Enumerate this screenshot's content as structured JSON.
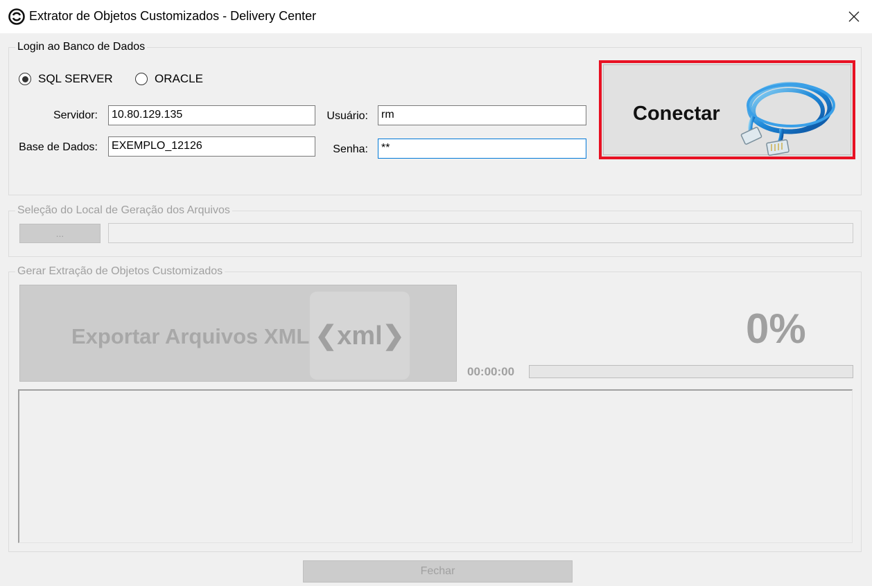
{
  "window": {
    "title": "Extrator de Objetos Customizados - Delivery Center",
    "close_icon": "close-icon",
    "app_icon": "app-logo-icon"
  },
  "login": {
    "legend": "Login ao Banco de Dados",
    "radio_sqlserver": "SQL SERVER",
    "radio_oracle": "ORACLE",
    "selected_db": "SQL SERVER",
    "servidor_label": "Servidor:",
    "servidor_value": "10.80.129.135",
    "basedados_label": "Base de Dados:",
    "basedados_value": "EXEMPLO_12126",
    "usuario_label": "Usuário:",
    "usuario_value": "rm",
    "senha_label": "Senha:",
    "senha_value": "**",
    "connect_button": "Conectar",
    "connect_icon": "network-cable-icon",
    "highlight_color": "#e81123"
  },
  "location": {
    "legend": "Seleção do Local de Geração dos Arquivos",
    "browse_button": "...",
    "path_value": ""
  },
  "export": {
    "legend": "Gerar Extração de Objetos Customizados",
    "export_button": "Exportar Arquivos XML",
    "xml_icon_text": "❮xml❯",
    "percent": "0%",
    "elapsed": "00:00:00",
    "progress": 0,
    "log_text": ""
  },
  "footer": {
    "close_button": "Fechar"
  }
}
